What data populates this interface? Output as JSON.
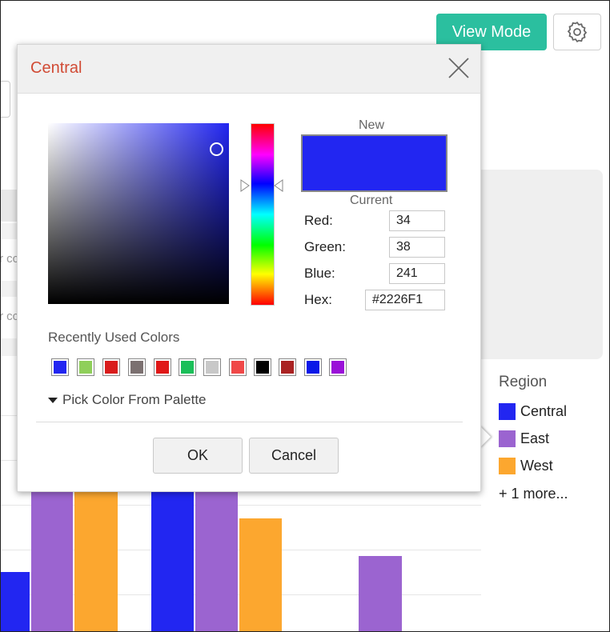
{
  "toolbar": {
    "view_mode_label": "View Mode",
    "settings_icon": "gear-icon",
    "accent_color": "#2bbf9f"
  },
  "background_text": [
    "r cc",
    "r cc"
  ],
  "legend": {
    "title": "Region",
    "items": [
      {
        "label": "Central",
        "color": "#2226F1"
      },
      {
        "label": "East",
        "color": "#9b64d0"
      },
      {
        "label": "West",
        "color": "#fca72f"
      }
    ],
    "more": "+ 1 more..."
  },
  "chart_colors": {
    "central": "#2226F1",
    "east": "#9b64d0",
    "west": "#fca72f"
  },
  "dialog": {
    "title": "Central",
    "close_icon": "close-icon",
    "new_label": "New",
    "current_label": "Current",
    "new_color": "#2226F1",
    "fields": {
      "red": {
        "label": "Red:",
        "value": "34"
      },
      "green": {
        "label": "Green:",
        "value": "38"
      },
      "blue": {
        "label": "Blue:",
        "value": "241"
      },
      "hex": {
        "label": "Hex:",
        "value": "#2226F1"
      }
    },
    "recent_label": "Recently Used Colors",
    "recent_colors": [
      "#2226F1",
      "#8fcf5a",
      "#d91c1c",
      "#7b7070",
      "#e01818",
      "#1bbf59",
      "#c8c8c8",
      "#f04848",
      "#000000",
      "#aa2222",
      "#0a18e8",
      "#9a10d8"
    ],
    "palette_toggle": "Pick Color From Palette",
    "ok_label": "OK",
    "cancel_label": "Cancel"
  }
}
